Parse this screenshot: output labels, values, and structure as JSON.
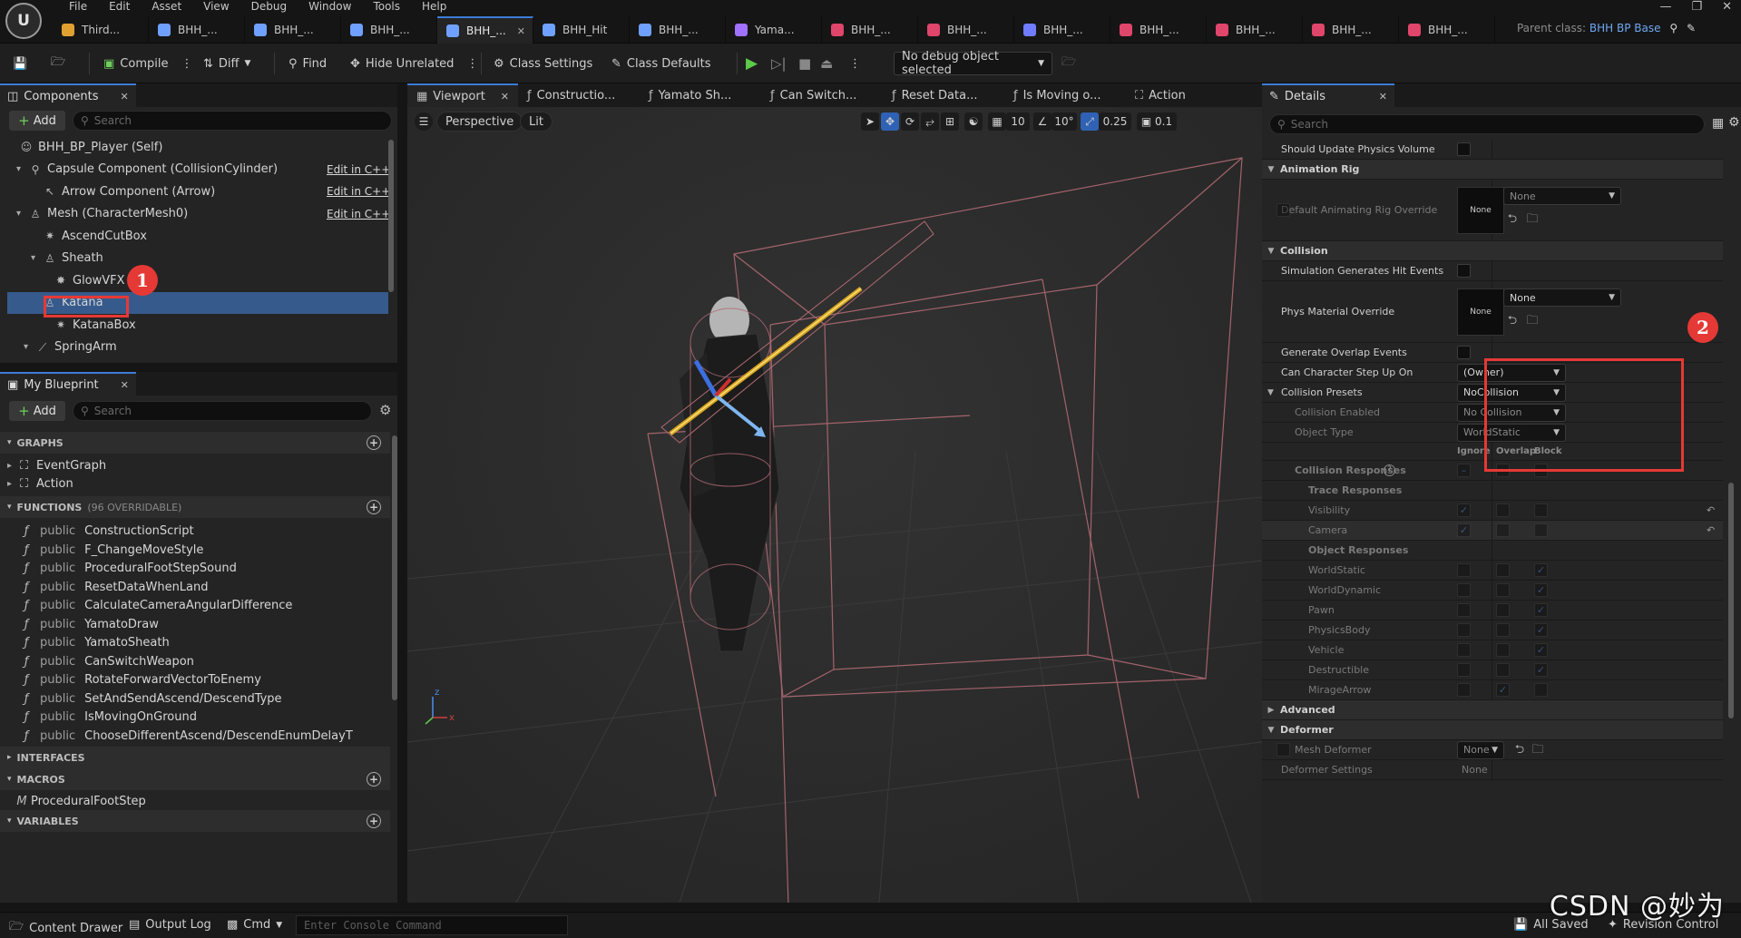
{
  "menu": [
    "File",
    "Edit",
    "Asset",
    "View",
    "Debug",
    "Window",
    "Tools",
    "Help"
  ],
  "logo_text": "U",
  "tabs": [
    {
      "label": "Third...",
      "color": "#e0a030"
    },
    {
      "label": "BHH_...",
      "color": "#6fa0ff"
    },
    {
      "label": "BHH_...",
      "color": "#6fa0ff"
    },
    {
      "label": "BHH_...",
      "color": "#6fa0ff"
    },
    {
      "label": "BHH_...",
      "color": "#6fa0ff",
      "active": true
    },
    {
      "label": "BHH_Hit",
      "color": "#6fa0ff"
    },
    {
      "label": "BHH_...",
      "color": "#6fa0ff"
    },
    {
      "label": "Yama...",
      "color": "#a070ff"
    },
    {
      "label": "BHH_...",
      "color": "#e0456b"
    },
    {
      "label": "BHH_...",
      "color": "#e0456b"
    },
    {
      "label": "BHH_...",
      "color": "#6f7cff"
    },
    {
      "label": "BHH_...",
      "color": "#e0456b"
    },
    {
      "label": "BHH_...",
      "color": "#e0456b"
    },
    {
      "label": "BHH_...",
      "color": "#e0456b"
    },
    {
      "label": "BHH_...",
      "color": "#e0456b"
    }
  ],
  "parent_class": {
    "label": "Parent class:",
    "value": "BHH BP Base"
  },
  "toolbar": {
    "compile": "Compile",
    "diff": "Diff",
    "find": "Find",
    "hide_unrelated": "Hide Unrelated",
    "class_settings": "Class Settings",
    "class_defaults": "Class Defaults",
    "debug_object": "No debug object selected"
  },
  "components_panel": {
    "title": "Components",
    "add": "Add",
    "search_placeholder": "Search",
    "items": [
      {
        "label": "BHH_BP_Player (Self)",
        "icon": "person-icon",
        "edit": ""
      },
      {
        "label": "Capsule Component (CollisionCylinder)",
        "icon": "capsule-icon",
        "edit": "Edit in C++"
      },
      {
        "label": "Arrow Component (Arrow)",
        "icon": "arrow-icon",
        "edit": "Edit in C++"
      },
      {
        "label": "Mesh (CharacterMesh0)",
        "icon": "skeletal-mesh-icon",
        "edit": "Edit in C++"
      },
      {
        "label": "AscendCutBox",
        "icon": "box-icon",
        "edit": ""
      },
      {
        "label": "Sheath",
        "icon": "skeletal-mesh-icon",
        "edit": ""
      },
      {
        "label": "GlowVFX",
        "icon": "vfx-icon",
        "edit": ""
      },
      {
        "label": "Katana",
        "icon": "skeletal-mesh-icon",
        "edit": ""
      },
      {
        "label": "KatanaBox",
        "icon": "box-icon",
        "edit": ""
      },
      {
        "label": "SpringArm",
        "icon": "spring-arm-icon",
        "edit": ""
      },
      {
        "label": "Camera",
        "icon": "camera-icon",
        "edit": ""
      }
    ]
  },
  "my_blueprint": {
    "title": "My Blueprint",
    "add": "Add",
    "search_placeholder": "Search",
    "graphs_header": "GRAPHS",
    "graphs": [
      "EventGraph",
      "Action"
    ],
    "functions_header": "FUNCTIONS",
    "functions_count": "(96 OVERRIDABLE)",
    "functions": [
      "ConstructionScript",
      "F_ChangeMoveStyle",
      "ProceduralFootStepSound",
      "ResetDataWhenLand",
      "CalculateCameraAngularDifference",
      "YamatoDraw",
      "YamatoSheath",
      "CanSwitchWeapon",
      "RotateForwardVectorToEnemy",
      "SetAndSendAscend/DescendType",
      "IsMovingOnGround",
      "ChooseDifferentAscend/DescendEnumDelayT"
    ],
    "public_label": "public",
    "interfaces_header": "INTERFACES",
    "macros_header": "MACROS",
    "macros": [
      "ProceduralFootStep"
    ],
    "variables_header": "VARIABLES"
  },
  "viewport_tabs": [
    "Viewport",
    "Constructio...",
    "Yamato Sh...",
    "Can Switch...",
    "Reset Data...",
    "Is Moving o...",
    "Action"
  ],
  "viewport_toolbar": {
    "perspective": "Perspective",
    "lit": "Lit",
    "grid": "10",
    "angle": "10°",
    "scale": "0.25",
    "camera_speed": "0.1"
  },
  "details": {
    "title": "Details",
    "search_placeholder": "Search",
    "should_update_physics": "Should Update Physics Volume",
    "animation_rig": "Animation Rig",
    "default_anim_rig": "Default Animating Rig Override",
    "none": "None",
    "collision": "Collision",
    "sim_hit_events": "Simulation Generates Hit Events",
    "phys_material": "Phys Material Override",
    "gen_overlap": "Generate Overlap Events",
    "can_step_up": "Can Character Step Up On",
    "can_step_up_value": "(Owner)",
    "collision_presets": "Collision Presets",
    "collision_presets_value": "NoCollision",
    "collision_enabled": "Collision Enabled",
    "collision_enabled_value": "No Collision",
    "object_type": "Object Type",
    "object_type_value": "WorldStatic",
    "col_ignore": "Ignore",
    "col_overlap": "Overlap",
    "col_block": "Block",
    "collision_responses": "Collision Responses",
    "trace_responses": "Trace Responses",
    "traces": [
      {
        "label": "Visibility",
        "state": "ignore"
      },
      {
        "label": "Camera",
        "state": "ignore"
      }
    ],
    "object_responses": "Object Responses",
    "objects": [
      {
        "label": "WorldStatic",
        "state": "block"
      },
      {
        "label": "WorldDynamic",
        "state": "block"
      },
      {
        "label": "Pawn",
        "state": "block"
      },
      {
        "label": "PhysicsBody",
        "state": "block"
      },
      {
        "label": "Vehicle",
        "state": "block"
      },
      {
        "label": "Destructible",
        "state": "block"
      },
      {
        "label": "MirageArrow",
        "state": "overlap"
      }
    ],
    "advanced": "Advanced",
    "deformer": "Deformer",
    "mesh_deformer": "Mesh Deformer",
    "deformer_settings": "Deformer Settings"
  },
  "bottom": {
    "content_drawer": "Content Drawer",
    "output_log": "Output Log",
    "cmd": "Cmd",
    "console_placeholder": "Enter Console Command",
    "all_saved": "All Saved",
    "revision_control": "Revision Control"
  },
  "annotations": [
    "1",
    "2"
  ],
  "watermark": "CSDN @妙为",
  "colors": {
    "accent": "#3c7dd6",
    "highlight": "#e53935",
    "selected_row": "#375a8c"
  }
}
